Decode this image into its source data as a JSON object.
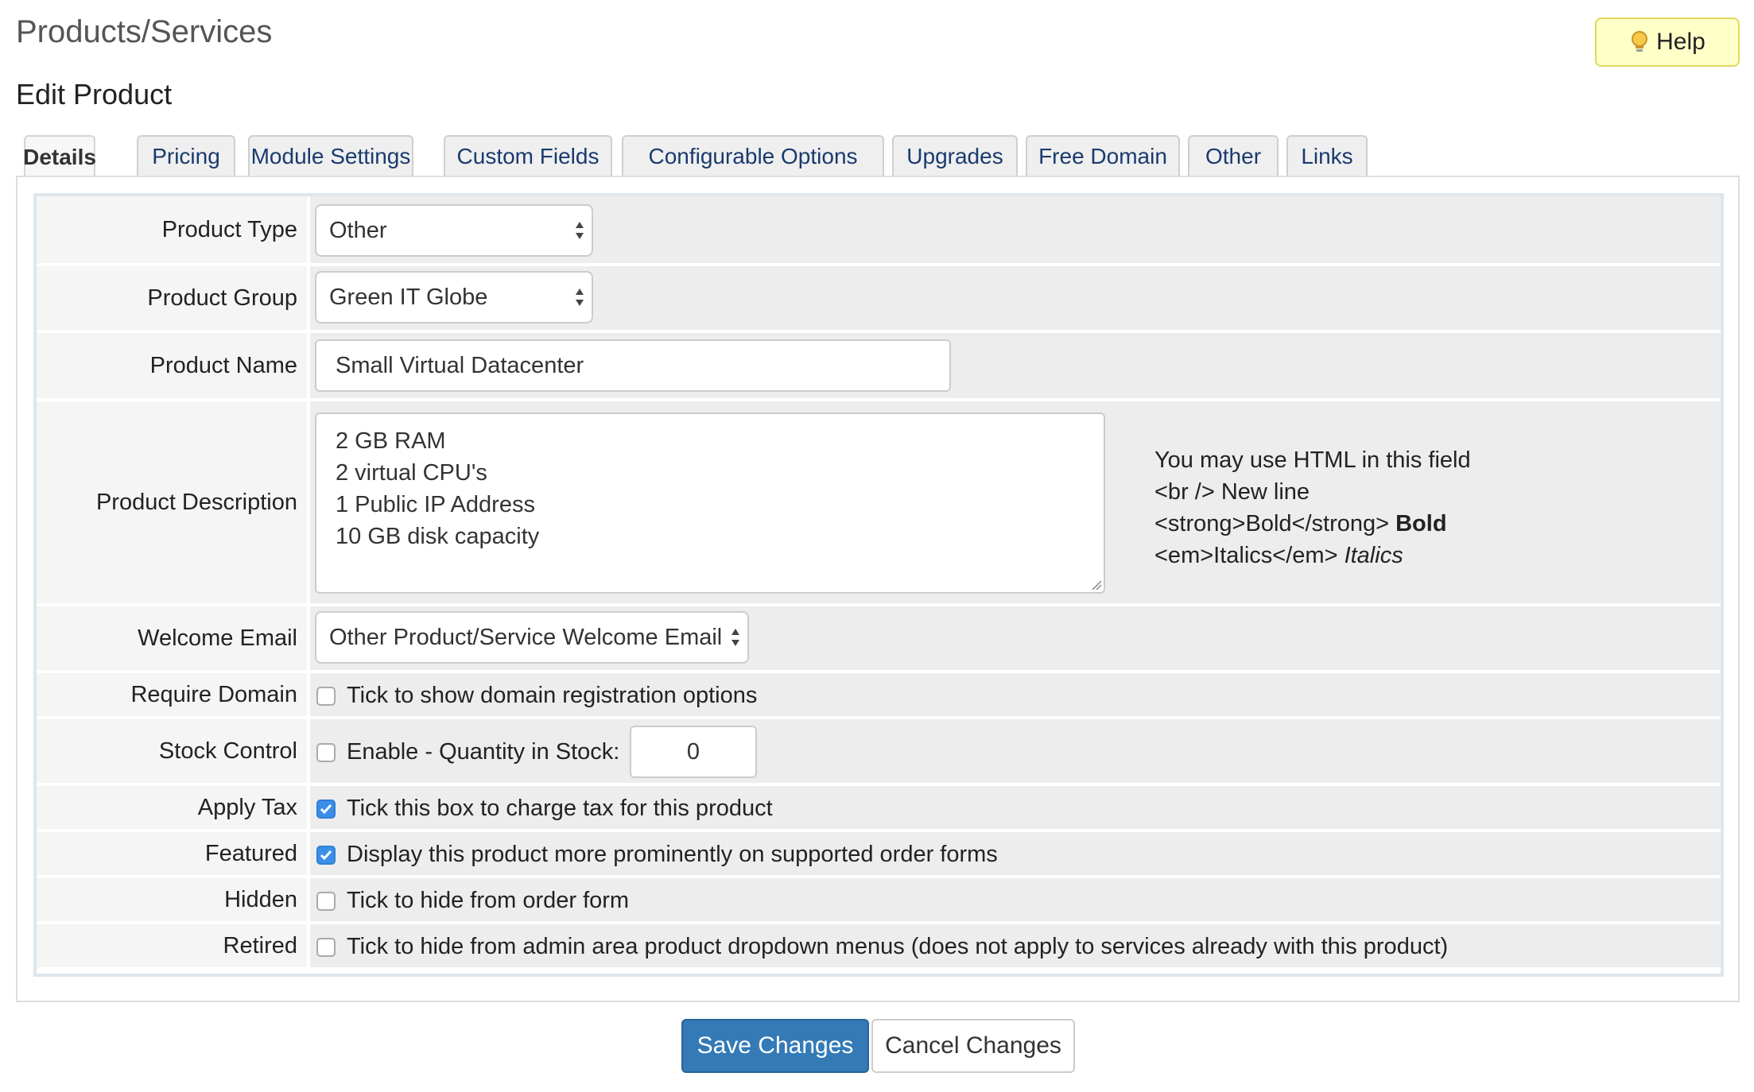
{
  "page": {
    "title": "Products/Services",
    "subtitle": "Edit Product"
  },
  "help_button": {
    "label": "Help",
    "icon": "lightbulb-icon"
  },
  "tabs": [
    {
      "label": "Details",
      "active": true
    },
    {
      "label": "Pricing",
      "active": false
    },
    {
      "label": "Module Settings",
      "active": false
    },
    {
      "label": "Custom Fields",
      "active": false
    },
    {
      "label": "Configurable Options",
      "active": false
    },
    {
      "label": "Upgrades",
      "active": false
    },
    {
      "label": "Free Domain",
      "active": false
    },
    {
      "label": "Other",
      "active": false
    },
    {
      "label": "Links",
      "active": false
    }
  ],
  "form": {
    "product_type": {
      "label": "Product Type",
      "value": "Other"
    },
    "product_group": {
      "label": "Product Group",
      "value": "Green IT Globe"
    },
    "product_name": {
      "label": "Product Name",
      "value": "Small Virtual Datacenter"
    },
    "product_description": {
      "label": "Product Description",
      "lines": [
        "2 GB RAM",
        "2 virtual CPU's",
        "1 Public IP Address",
        "10 GB disk capacity"
      ],
      "hint": {
        "line1": "You may use HTML in this field",
        "line2": "<br /> New line",
        "line3_code": "<strong>Bold</strong>",
        "line3_example": "Bold",
        "line4_code": "<em>Italics</em>",
        "line4_example": "Italics"
      }
    },
    "welcome_email": {
      "label": "Welcome Email",
      "value": "Other Product/Service Welcome Email"
    },
    "require_domain": {
      "label": "Require Domain",
      "text": "Tick to show domain registration options",
      "checked": false
    },
    "stock_control": {
      "label": "Stock Control",
      "text": "Enable - Quantity in Stock:",
      "checked": false,
      "quantity": "0"
    },
    "apply_tax": {
      "label": "Apply Tax",
      "text": "Tick this box to charge tax for this product",
      "checked": true
    },
    "featured": {
      "label": "Featured",
      "text": "Display this product more prominently on supported order forms",
      "checked": true
    },
    "hidden": {
      "label": "Hidden",
      "text": "Tick to hide from order form",
      "checked": false
    },
    "retired": {
      "label": "Retired",
      "text": "Tick to hide from admin area product dropdown menus (does not apply to services already with this product)",
      "checked": false
    }
  },
  "buttons": {
    "save": "Save Changes",
    "cancel": "Cancel Changes"
  },
  "colors": {
    "primary": "#337ab7",
    "help_bg": "#ffffc8",
    "checkbox_checked": "#3b8fe8",
    "tab_text": "#1a3a6e"
  }
}
